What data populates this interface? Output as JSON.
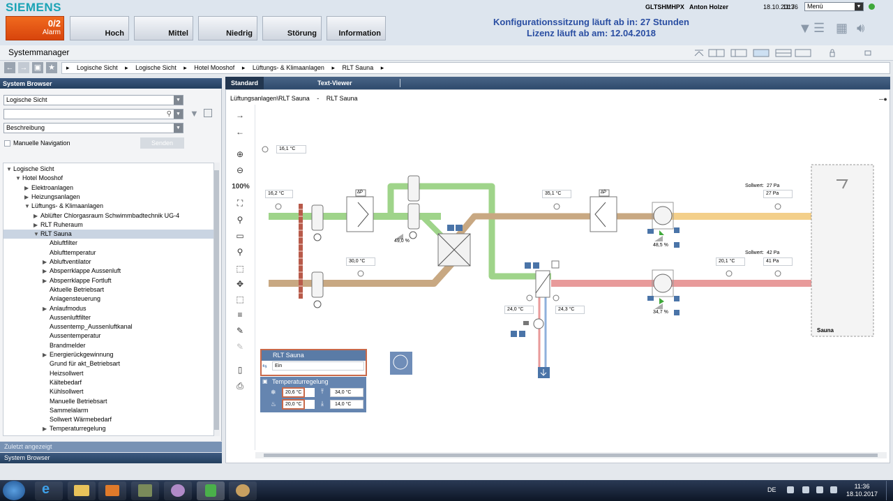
{
  "header": {
    "brand": "SIEMENS",
    "alarm": {
      "count": "0/2",
      "label": "Alarm"
    },
    "categories": [
      "Hoch",
      "Mittel",
      "Niedrig",
      "Störung",
      "Information"
    ],
    "session_line1": "Konfigurationssitzung läuft ab in: 27 Stunden",
    "session_line2": "Lizenz läuft ab am: 12.04.2018",
    "host": "GLTSHMHPX",
    "user": "Anton Holzer",
    "date": "18.10.2017",
    "time": "11:36",
    "menu": "Menü"
  },
  "system": {
    "title": "Systemmanager"
  },
  "breadcrumb": [
    "Logische Sicht",
    "Logische Sicht",
    "Hotel Mooshof",
    "Lüftungs- & Klimaanlagen",
    "RLT Sauna"
  ],
  "browser": {
    "title": "System Browser",
    "view_select": "Logische Sicht",
    "search_placeholder": "",
    "display_select": "Beschreibung",
    "manual_nav": "Manuelle Navigation",
    "send": "Senden",
    "recent": "Zuletzt angezeigt",
    "footer": "System Browser",
    "tree": [
      {
        "label": "Logische Sicht",
        "level": 0,
        "arrow": "▼"
      },
      {
        "label": "Hotel Mooshof",
        "level": 1,
        "arrow": "▼"
      },
      {
        "label": "Elektroanlagen",
        "level": 2,
        "arrow": "▶"
      },
      {
        "label": "Heizungsanlagen",
        "level": 2,
        "arrow": "▶"
      },
      {
        "label": "Lüftungs- & Klimaanlagen",
        "level": 2,
        "arrow": "▼"
      },
      {
        "label": "Ablüfter Chlorgasraum Schwimmbadtechnik UG-4",
        "level": 3,
        "arrow": "▶"
      },
      {
        "label": "RLT Ruheraum",
        "level": 3,
        "arrow": "▶"
      },
      {
        "label": "RLT Sauna",
        "level": 3,
        "arrow": "▼",
        "selected": true
      },
      {
        "label": "Abluftfilter",
        "level": 4,
        "arrow": ""
      },
      {
        "label": "Ablufttemperatur",
        "level": 4,
        "arrow": ""
      },
      {
        "label": "Abluftventilator",
        "level": 4,
        "arrow": "▶"
      },
      {
        "label": "Absperrklappe Aussenluft",
        "level": 4,
        "arrow": "▶"
      },
      {
        "label": "Absperrklappe Fortluft",
        "level": 4,
        "arrow": "▶"
      },
      {
        "label": "Aktuelle Betriebsart",
        "level": 4,
        "arrow": ""
      },
      {
        "label": "Anlagensteuerung",
        "level": 4,
        "arrow": ""
      },
      {
        "label": "Anlaufmodus",
        "level": 4,
        "arrow": "▶"
      },
      {
        "label": "Aussenluftfilter",
        "level": 4,
        "arrow": ""
      },
      {
        "label": "Aussentemp_Aussenluftkanal",
        "level": 4,
        "arrow": ""
      },
      {
        "label": "Aussentemperatur",
        "level": 4,
        "arrow": ""
      },
      {
        "label": "Brandmelder",
        "level": 4,
        "arrow": ""
      },
      {
        "label": "Energierückgewinnung",
        "level": 4,
        "arrow": "▶"
      },
      {
        "label": "Grund für akt_Betriebsart",
        "level": 4,
        "arrow": ""
      },
      {
        "label": "Heizsollwert",
        "level": 4,
        "arrow": ""
      },
      {
        "label": "Kältebedarf",
        "level": 4,
        "arrow": ""
      },
      {
        "label": "Kühlsollwert",
        "level": 4,
        "arrow": ""
      },
      {
        "label": "Manuelle Betriebsart",
        "level": 4,
        "arrow": ""
      },
      {
        "label": "Sammelalarm",
        "level": 4,
        "arrow": ""
      },
      {
        "label": "Sollwert Wärmebedarf",
        "level": 4,
        "arrow": ""
      },
      {
        "label": "Temperaturregelung",
        "level": 4,
        "arrow": "▶"
      }
    ]
  },
  "viewer": {
    "tabs": [
      "Standard",
      "Text-Viewer"
    ],
    "path_left": "Lüftungsanlagen\\RLT Sauna",
    "path_sep": "-",
    "path_right": "RLT Sauna",
    "zoom": "100%"
  },
  "plant": {
    "outside_temp": "16,1 °C",
    "supply_inlet_temp": "16,2 °C",
    "mixing_damper": "49,0 %",
    "after_hrc_temp": "35,1 °C",
    "supply_setpoint_label": "Sollwert:",
    "supply_setpoint": "27 Pa",
    "supply_pressure": "27 Pa",
    "supply_fan": "48,5 %",
    "return_temp": "30,0 °C",
    "exhaust_setpoint_label": "Sollwert:",
    "exhaust_setpoint": "42 Pa",
    "exhaust_pressure": "41 Pa",
    "exhaust_temp": "20,1 °C",
    "exhaust_fan": "34,7 %",
    "coil_temp_left": "24,0 °C",
    "coil_temp_right": "24,3 °C",
    "room_label": "Sauna",
    "dp_label": "ΔP",
    "box_title": "RLT Sauna",
    "box_value": "Ein",
    "reg_title": "Temperaturregelung",
    "cool_sp": "20,6 °C",
    "heat_sp": "20,0 °C",
    "max_temp": "34,0 °C",
    "min_temp": "14,0 °C"
  },
  "taskbar": {
    "lang": "DE",
    "time": "11:36",
    "date": "18.10.2017"
  },
  "colors": {
    "supply": "#9fd48a",
    "return": "#c8a882",
    "exhaust_warm": "#f3cf8a",
    "exhaust_hot": "#e89a9a",
    "brand": "#1aa3b5",
    "alarm": "#e65a17",
    "header_blue": "#2a4ea2"
  }
}
